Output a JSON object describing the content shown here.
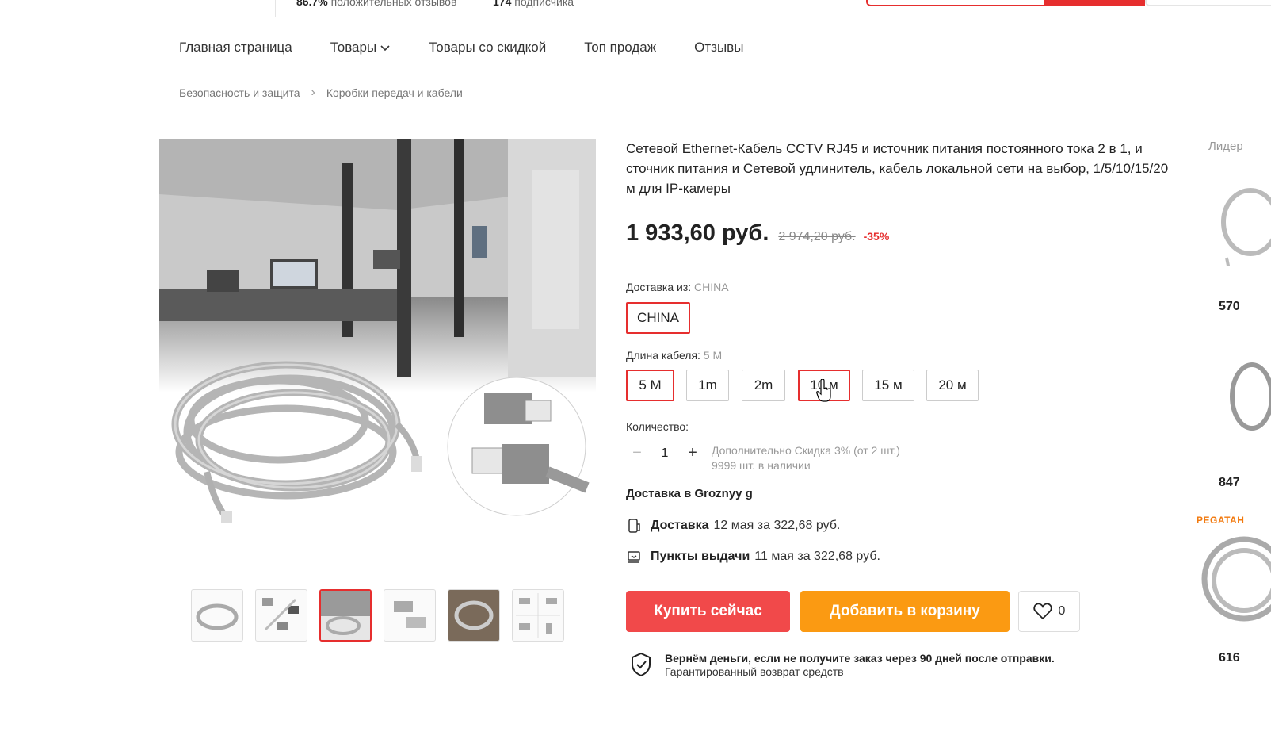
{
  "topbar": {
    "stat_percent": "86.7%",
    "stat_reviews_label": "положительных отзывов",
    "stat_subs_count": "174",
    "stat_subs_label": "подписчика"
  },
  "nav": {
    "items": [
      "Главная страница",
      "Товары",
      "Товары со скидкой",
      "Топ продаж",
      "Отзывы"
    ]
  },
  "breadcrumbs": [
    "Безопасность и защита",
    "Коробки передач и кабели"
  ],
  "product": {
    "title": "Сетевой Ethernet-Кабель CCTV RJ45 и источник питания постоянного тока 2 в 1, и сточник питания и Сетевой удлинитель, кабель локальной сети на выбор, 1/5/10/15/20 м для IP-камеры",
    "price": "1 933,60 руб.",
    "old_price": "2 974,20 руб.",
    "discount": "-35%"
  },
  "shipping_from": {
    "label": "Доставка из:",
    "value": "CHINA",
    "options": [
      "CHINA"
    ]
  },
  "cable_length": {
    "label": "Длина кабеля:",
    "value": "5 М",
    "options": [
      "5 М",
      "1m",
      "2m",
      "10 м",
      "15 м",
      "20 м"
    ]
  },
  "quantity": {
    "label": "Количество:",
    "value": "1",
    "extra_discount": "Дополнительно Скидка 3% (от 2 шт.)",
    "stock": "9999 шт. в наличии"
  },
  "delivery": {
    "heading": "Доставка в Groznyy g",
    "courier_label": "Доставка",
    "courier_value": "12 мая за 322,68 руб.",
    "pickup_label": "Пункты выдачи",
    "pickup_value": "11 мая за 322,68 руб."
  },
  "actions": {
    "buy_now": "Купить сейчас",
    "add_to_cart": "Добавить в корзину",
    "wishlist_count": "0"
  },
  "guarantee": {
    "line1": "Вернём деньги, если не получите заказ через 90 дней после отправки.",
    "line2": "Гарантированный возврат средств"
  },
  "sidebar": {
    "header": "Лидер",
    "prices": [
      "570",
      "847",
      "616"
    ],
    "brand": "PEGATAH"
  },
  "colors": {
    "accent_red": "#e62e2e",
    "buy_button": "#f1494a",
    "cart_button": "#fb9a12"
  }
}
